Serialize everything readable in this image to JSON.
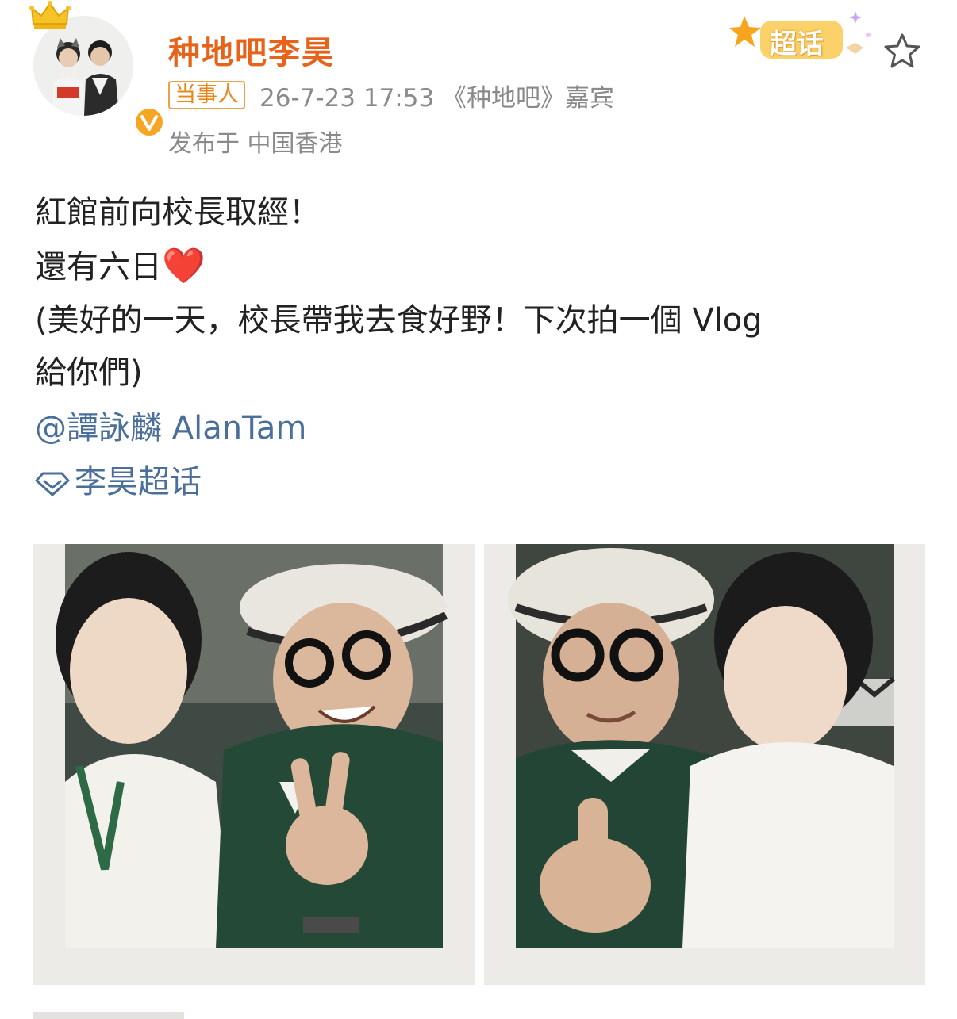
{
  "header": {
    "username": "种地吧李昊",
    "role_badge": "当事人",
    "meta": "26-7-23 17:53 《种地吧》嘉宾",
    "location": "发布于 中国香港",
    "supertopic_badge": "超话"
  },
  "content": {
    "line1": "紅館前向校長取經！",
    "line2": "還有六日",
    "line2_emoji": "❤️",
    "line3": "(美好的一天，校長帶我去食好野！下次拍一個 Vlog",
    "line4": "給你們)",
    "mention": "@譚詠麟 AlanTam",
    "topic": "李昊超话"
  },
  "colors": {
    "username": "#e8631a",
    "link": "#4a6f9a",
    "meta": "#8a8a8a",
    "badge_border": "#e8a24a"
  },
  "icons": {
    "avatar": "avatar-image",
    "crown": "crown-icon",
    "verified": "verified-badge-icon",
    "star": "star-icon",
    "topic": "supertopic-diamond-icon"
  }
}
